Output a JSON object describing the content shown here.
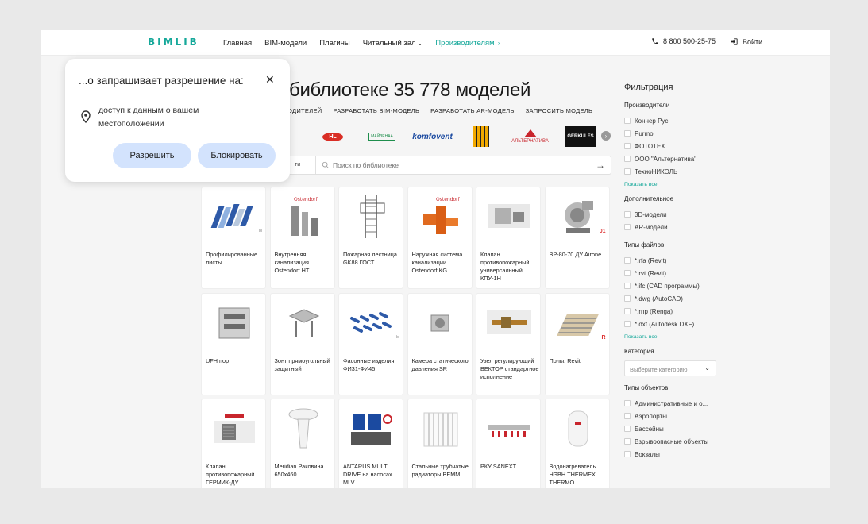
{
  "header": {
    "logo": "BIMLIB",
    "nav": [
      {
        "label": "Главная"
      },
      {
        "label": "BIM-модели"
      },
      {
        "label": "Плагины"
      },
      {
        "label": "Читальный зал"
      },
      {
        "label": "Производителям"
      }
    ],
    "phone": "8 800 500-25-75",
    "login": "Войти"
  },
  "main": {
    "heading": "библиотеке 35 778 моделей",
    "actions": [
      "ОДИТЕЛЕЙ",
      "РАЗРАБОТАТЬ BIM-МОДЕЛЬ",
      "РАЗРАБОТАТЬ AR-МОДЕЛЬ",
      "ЗАПРОСИТЬ МОДЕЛЬ"
    ],
    "brands": {
      "hl": "HL",
      "mh": "МАЙЗЕНАА",
      "komfovent": "komfovent",
      "alt": "АЛЬТЕРНАТИВА",
      "gerkules": "GERKULES"
    },
    "search": {
      "selector": "ти",
      "placeholder": "Поиск по библиотеке"
    }
  },
  "products": [
    {
      "name": "Профилированные листы",
      "icon": "blue-sheets",
      "badge": "bl"
    },
    {
      "name": "Внутренняя канализация Ostendorf HT",
      "icon": "grey-pipes",
      "badge": ""
    },
    {
      "name": "Пожарная лестница GK88 ГОСТ",
      "icon": "ladder",
      "badge": ""
    },
    {
      "name": "Наружная система канализации Ostendorf KG",
      "icon": "orange-pipes",
      "badge": ""
    },
    {
      "name": "Клапан противопожарный универсальный КПУ-1Н",
      "icon": "valve",
      "badge": ""
    },
    {
      "name": "ВР-80-70 ДУ Airone",
      "icon": "fan",
      "badge": "01"
    },
    {
      "name": "UFH порт",
      "icon": "cabinet",
      "badge": ""
    },
    {
      "name": "Зонт прямоугольный защитный",
      "icon": "hood",
      "badge": ""
    },
    {
      "name": "Фасонные изделия ФИ31-ФИ45",
      "icon": "blue-fittings",
      "badge": "bl"
    },
    {
      "name": "Камера статического давления SR",
      "icon": "box",
      "badge": ""
    },
    {
      "name": "Узел регулирующий ВЕКТОР стандартное исполнение",
      "icon": "pipe-unit",
      "badge": ""
    },
    {
      "name": "Полы. Revit",
      "icon": "floor",
      "badge": "R"
    },
    {
      "name": "Клапан противопожарный ГЕРМИК-ДУ",
      "icon": "grille",
      "badge": ""
    },
    {
      "name": "Meridian Раковина 650x460",
      "icon": "sink",
      "badge": ""
    },
    {
      "name": "ANTARUS MULTI DRIVE на насосах MLV",
      "icon": "pumps",
      "badge": ""
    },
    {
      "name": "Стальные трубчатые радиаторы BEMM",
      "icon": "radiator",
      "badge": ""
    },
    {
      "name": "РКУ SANEXT",
      "icon": "manifold",
      "badge": ""
    },
    {
      "name": "Водонагреватель НЭВН THERMEX THERMO",
      "icon": "boiler",
      "badge": ""
    }
  ],
  "filters": {
    "title": "Фильтрация",
    "manufacturers_title": "Производители",
    "manufacturers": [
      "Коннер Рус",
      "Purmo",
      "ФОТОТЕХ",
      "ООО \"Альтернатива\"",
      "ТехноНИКОЛЬ"
    ],
    "show_all": "Показать все",
    "extra_title": "Дополнительное",
    "extra": [
      "3D-модели",
      "AR-модели"
    ],
    "filetypes_title": "Типы файлов",
    "filetypes": [
      "*.rfa (Revit)",
      "*.rvt (Revit)",
      "*.ifc (CAD программы)",
      "*.dwg (AutoCAD)",
      "*.rnp (Renga)",
      "*.dxf (Autodesk DXF)"
    ],
    "category_title": "Категория",
    "category_placeholder": "Выберите категорию",
    "objects_title": "Типы объектов",
    "objects": [
      "Административные и о...",
      "Аэропорты",
      "Бассейны",
      "Взрывоопасные объекты",
      "Вокзалы"
    ]
  },
  "permission_popup": {
    "title": "...о запрашивает разрешение на:",
    "message": "доступ к данным о вашем местоположении",
    "allow": "Разрешить",
    "block": "Блокировать"
  },
  "colors": {
    "accent": "#16a89a",
    "button": "#d3e3fd"
  }
}
